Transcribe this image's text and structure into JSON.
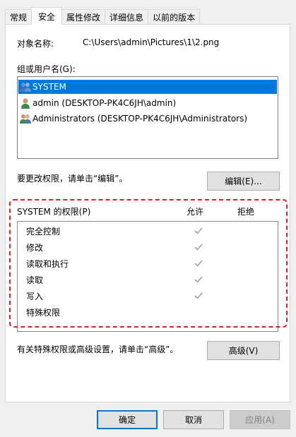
{
  "tabs": [
    "常规",
    "安全",
    "属性修改",
    "详细信息",
    "以前的版本"
  ],
  "object_name_label": "对象名称:",
  "object_name_value": "C:\\Users\\admin\\Pictures\\1\\2.png",
  "group_label": "组或用户名(G):",
  "users": [
    {
      "name": "SYSTEM",
      "icon": "users-group-icon"
    },
    {
      "name": "admin (DESKTOP-PK4C6JH\\admin)",
      "icon": "user-icon"
    },
    {
      "name": "Administrators (DESKTOP-PK4C6JH\\Administrators)",
      "icon": "users-group-icon"
    }
  ],
  "change_hint": "要更改权限，请单击“编辑”。",
  "edit_button": "编辑(E)...",
  "perm_header": "SYSTEM 的权限(P)",
  "allow_header": "允许",
  "deny_header": "拒绝",
  "permissions": [
    {
      "name": "完全控制",
      "allow": true
    },
    {
      "name": "修改",
      "allow": true
    },
    {
      "name": "读取和执行",
      "allow": true
    },
    {
      "name": "读取",
      "allow": true
    },
    {
      "name": "写入",
      "allow": true
    },
    {
      "name": "特殊权限",
      "allow": false
    }
  ],
  "advanced_hint": "有关特殊权限或高级设置，请单击“高级”。",
  "advanced_button": "高级(V)",
  "ok_button": "确定",
  "cancel_button": "取消",
  "apply_button": "应用(A)",
  "colors": {
    "selection": "#0078d7",
    "highlight_dash": "#e02020",
    "check": "#a0a0a0"
  }
}
